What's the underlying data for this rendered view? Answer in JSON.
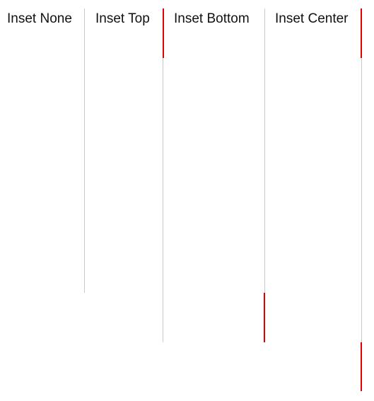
{
  "columns": [
    {
      "label": "Inset None"
    },
    {
      "label": "Inset Top"
    },
    {
      "label": "Inset Bottom"
    },
    {
      "label": "Inset Center"
    }
  ],
  "colors": {
    "divider": "#c8c8c8",
    "inset_marker": "#e00000",
    "text": "#111111",
    "background": "#ffffff"
  }
}
